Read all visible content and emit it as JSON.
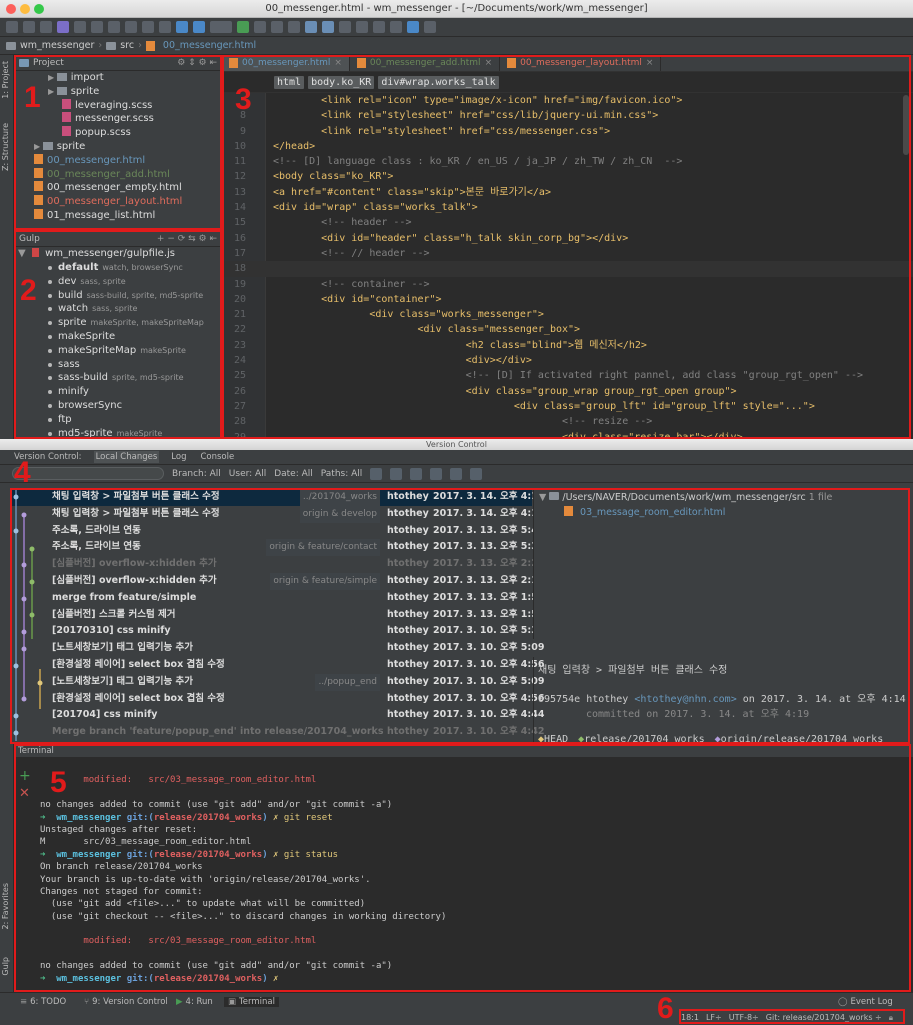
{
  "window": {
    "title": "00_messenger.html - wm_messenger - [~/Documents/work/wm_messenger]"
  },
  "breadcrumb": [
    "wm_messenger",
    "src",
    "00_messenger.html"
  ],
  "side_tabs": {
    "project": "1: Project",
    "structure": "Z: Structure",
    "favorites": "2: Favorites",
    "gulp": "Gulp"
  },
  "project": {
    "header": "Project",
    "items": [
      {
        "label": "import",
        "type": "folder",
        "indent": 2
      },
      {
        "label": "sprite",
        "type": "folder",
        "indent": 2
      },
      {
        "label": "leveraging.scss",
        "type": "scss",
        "indent": 3
      },
      {
        "label": "messenger.scss",
        "type": "scss",
        "indent": 3
      },
      {
        "label": "popup.scss",
        "type": "scss",
        "indent": 3
      },
      {
        "label": "sprite",
        "type": "folder",
        "indent": 1
      },
      {
        "label": "00_messenger.html",
        "type": "html",
        "indent": 1,
        "color": "#6897bb"
      },
      {
        "label": "00_messenger_add.html",
        "type": "html",
        "indent": 1,
        "color": "#6a8759"
      },
      {
        "label": "00_messenger_empty.html",
        "type": "html",
        "indent": 1,
        "color": "#dddddd"
      },
      {
        "label": "00_messenger_layout.html",
        "type": "html",
        "indent": 1,
        "color": "#e06c5c"
      },
      {
        "label": "01_message_list.html",
        "type": "html",
        "indent": 1,
        "color": "#dddddd"
      }
    ]
  },
  "gulp": {
    "header": "Gulp",
    "root": "wm_messenger/gulpfile.js",
    "tasks": [
      {
        "name": "default",
        "deps": "watch, browserSync",
        "bold": true
      },
      {
        "name": "dev",
        "deps": "sass, sprite"
      },
      {
        "name": "build",
        "deps": "sass-build, sprite, md5-sprite"
      },
      {
        "name": "watch",
        "deps": "sass, sprite"
      },
      {
        "name": "sprite",
        "deps": "makeSprite, makeSpriteMap"
      },
      {
        "name": "makeSprite",
        "deps": ""
      },
      {
        "name": "makeSpriteMap",
        "deps": "makeSprite"
      },
      {
        "name": "sass",
        "deps": ""
      },
      {
        "name": "sass-build",
        "deps": "sprite, md5-sprite"
      },
      {
        "name": "minify",
        "deps": ""
      },
      {
        "name": "browserSync",
        "deps": ""
      },
      {
        "name": "ftp",
        "deps": ""
      },
      {
        "name": "md5-sprite",
        "deps": "makeSprite"
      }
    ]
  },
  "editor": {
    "tabs": [
      {
        "label": "00_messenger.html",
        "color": "#6897bb",
        "active": true
      },
      {
        "label": "00_messenger_add.html",
        "color": "#6a8759"
      },
      {
        "label": "00_messenger_layout.html",
        "color": "#e06c5c"
      }
    ],
    "crumbs": [
      "html",
      "body.ko_KR",
      "div#wrap.works_talk"
    ],
    "lines": [
      {
        "n": "",
        "t": "        <link rel=\"icon\" type=\"image/x-icon\" href=\"img/favicon.ico\">"
      },
      {
        "n": "8",
        "t": "        <link rel=\"stylesheet\" href=\"css/lib/jquery-ui.min.css\">"
      },
      {
        "n": "9",
        "t": "        <link rel=\"stylesheet\" href=\"css/messenger.css\">"
      },
      {
        "n": "10",
        "t": "</head>"
      },
      {
        "n": "11",
        "t": "<!-- [D] language class : ko_KR / en_US / ja_JP / zh_TW / zh_CN  -->"
      },
      {
        "n": "12",
        "t": "<body class=\"ko_KR\">"
      },
      {
        "n": "13",
        "t": "<a href=\"#content\" class=\"skip\">본문 바로가기</a>"
      },
      {
        "n": "14",
        "t": "<div id=\"wrap\" class=\"works_talk\">"
      },
      {
        "n": "15",
        "t": "        <!-- header -->"
      },
      {
        "n": "16",
        "t": "        <div id=\"header\" class=\"h_talk skin_corp_bg\"></div>"
      },
      {
        "n": "17",
        "t": "        <!-- // header -->"
      },
      {
        "n": "18",
        "t": ""
      },
      {
        "n": "19",
        "t": "        <!-- container -->"
      },
      {
        "n": "20",
        "t": "        <div id=\"container\">"
      },
      {
        "n": "21",
        "t": "                <div class=\"works_messenger\">"
      },
      {
        "n": "22",
        "t": "                        <div class=\"messenger_box\">"
      },
      {
        "n": "23",
        "t": "                                <h2 class=\"blind\">웹 메신저</h2>"
      },
      {
        "n": "24",
        "t": "                                <div></div>"
      },
      {
        "n": "25",
        "t": "                                <!-- [D] If activated right pannel, add class \"group_rgt_open\" -->"
      },
      {
        "n": "26",
        "t": "                                <div class=\"group_wrap group_rgt_open group\">"
      },
      {
        "n": "27",
        "t": "                                        <div class=\"group_lft\" id=\"group_lft\" style=\"...\">"
      },
      {
        "n": "28",
        "t": "                                                <!-- resize -->"
      },
      {
        "n": "29",
        "t": "                                                <div class=\"resize_bar\"></div>"
      }
    ]
  },
  "vc": {
    "title": "Version Control",
    "tabs": [
      "Version Control:",
      "Local Changes",
      "Log",
      "Console"
    ],
    "filters": [
      "Branch: All",
      "User: All",
      "Date: All",
      "Paths: All"
    ],
    "log": [
      {
        "msg": "채팅 입력창 > 파일첨부 버튼 클래스 수정",
        "tag": "../201704_works",
        "author": "htothey",
        "date": "2017. 3. 14. 오후 4:14",
        "sel": true
      },
      {
        "msg": "채팅 입력창 > 파일첨부 버튼 클래스 수정",
        "tag": "origin & develop",
        "author": "htothey",
        "date": "2017. 3. 14. 오후 4:14"
      },
      {
        "msg": "주소록, 드라이브 연동",
        "tag": "",
        "author": "htothey",
        "date": "2017. 3. 13. 오후 5:43"
      },
      {
        "msg": "주소록, 드라이브 연동",
        "tag": "origin & feature/contact",
        "author": "htothey",
        "date": "2017. 3. 13. 오후 5:36"
      },
      {
        "msg": "[심플버전] overflow-x:hidden 추가",
        "tag": "",
        "author": "htothey",
        "date": "2017. 3. 13. 오후 2:22",
        "dim": true
      },
      {
        "msg": "[심플버전] overflow-x:hidden 추가",
        "tag": "origin & feature/simple",
        "author": "htothey",
        "date": "2017. 3. 13. 오후 2:19"
      },
      {
        "msg": "merge from feature/simple",
        "tag": "",
        "author": "htothey",
        "date": "2017. 3. 13. 오후 1:59"
      },
      {
        "msg": "[심플버전] 스크롤 커스텀 제거",
        "tag": "",
        "author": "htothey",
        "date": "2017. 3. 13. 오후 1:50"
      },
      {
        "msg": "[20170310] css minify",
        "tag": "",
        "author": "htothey",
        "date": "2017. 3. 10. 오후 5:32"
      },
      {
        "msg": "[노트세창보기] 태그 입력기능 추가",
        "tag": "",
        "author": "htothey",
        "date": "2017. 3. 10. 오후 5:09"
      },
      {
        "msg": "[환경설정 레이어] select box 겹침 수정",
        "tag": "",
        "author": "htothey",
        "date": "2017. 3. 10. 오후 4:56"
      },
      {
        "msg": "[노트세창보기] 태그 입력기능 추가",
        "tag": "../popup_end",
        "author": "htothey",
        "date": "2017. 3. 10. 오후 5:09"
      },
      {
        "msg": "[환경설정 레이어] select box 겹침 수정",
        "tag": "",
        "author": "htothey",
        "date": "2017. 3. 10. 오후 4:56"
      },
      {
        "msg": "[201704] css minify",
        "tag": "",
        "author": "htothey",
        "date": "2017. 3. 10. 오후 4:44"
      },
      {
        "msg": "Merge branch 'feature/popup_end' into release/201704_works",
        "tag": "",
        "author": "htothey",
        "date": "2017. 3. 10. 오후 4:42",
        "dim": true
      }
    ],
    "files_path": "/Users/NAVER/Documents/work/wm_messenger/src",
    "files_count": "1 file",
    "file": "03_message_room_editor.html",
    "detail_msg": "채팅 입력창 > 파일첨부 버튼 클래스 수정",
    "detail_hash": "095754e",
    "detail_author": "htothey",
    "detail_email": "<htothey@nhn.com>",
    "detail_on": "on 2017. 3. 14. at 오후 4:14",
    "detail_committed": "committed on 2017. 3. 14. at 오후 4:19",
    "refs": [
      "HEAD",
      "release/201704_works",
      "origin/release/201704_works"
    ]
  },
  "terminal": {
    "title": "Terminal",
    "lines": [
      {
        "t": "",
        "c": "#ccc"
      },
      {
        "t": "        modified:   src/03_message_room_editor.html",
        "c": "#e06060"
      },
      {
        "t": "",
        "c": "#ccc"
      },
      {
        "t": "no changes added to commit (use \"git add\" and/or \"git commit -a\")",
        "c": "#ccc"
      },
      {
        "t": "➜  wm_messenger git:(release/201704_works) ✗ git reset",
        "c": "#ccc",
        "prompt": true
      },
      {
        "t": "Unstaged changes after reset:",
        "c": "#ccc"
      },
      {
        "t": "M       src/03_message_room_editor.html",
        "c": "#ccc"
      },
      {
        "t": "➜  wm_messenger git:(release/201704_works) ✗ git status",
        "c": "#ccc",
        "prompt": true
      },
      {
        "t": "On branch release/201704_works",
        "c": "#ccc"
      },
      {
        "t": "Your branch is up-to-date with 'origin/release/201704_works'.",
        "c": "#ccc"
      },
      {
        "t": "Changes not staged for commit:",
        "c": "#ccc"
      },
      {
        "t": "  (use \"git add <file>...\" to update what will be committed)",
        "c": "#ccc"
      },
      {
        "t": "  (use \"git checkout -- <file>...\" to discard changes in working directory)",
        "c": "#ccc"
      },
      {
        "t": "",
        "c": "#ccc"
      },
      {
        "t": "        modified:   src/03_message_room_editor.html",
        "c": "#e06060"
      },
      {
        "t": "",
        "c": "#ccc"
      },
      {
        "t": "no changes added to commit (use \"git add\" and/or \"git commit -a\")",
        "c": "#ccc"
      },
      {
        "t": "➜  wm_messenger git:(release/201704_works) ✗",
        "c": "#ccc",
        "prompt": true
      }
    ]
  },
  "bottom_tabs": [
    {
      "label": "6: TODO"
    },
    {
      "label": "9: Version Control"
    },
    {
      "label": "4: Run"
    },
    {
      "label": "Terminal"
    }
  ],
  "event_log": "Event Log",
  "statusbar": {
    "pos": "18:1",
    "le": "LF÷",
    "enc": "UTF-8÷",
    "git": "Git: release/201704_works ÷"
  },
  "annotations": [
    "1",
    "2",
    "3",
    "4",
    "5",
    "6"
  ],
  "colors": {
    "accent": "#e11b1b",
    "html_blue": "#6897bb",
    "added_green": "#6a8759",
    "modified_red": "#e06c5c"
  }
}
